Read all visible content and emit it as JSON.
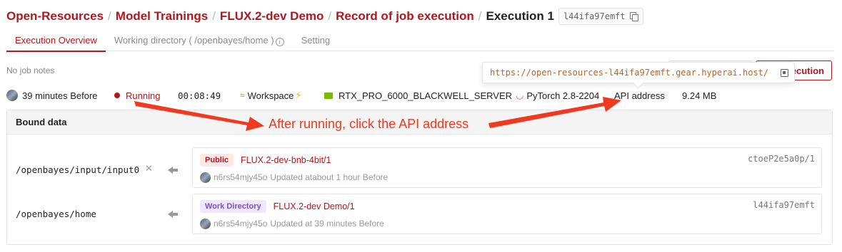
{
  "breadcrumb": {
    "items": [
      "Open-Resources",
      "Model Trainings",
      "FLUX.2-dev Demo",
      "Record of job execution"
    ],
    "separator": "/",
    "current": "Execution 1",
    "id": "l44ifa97emft"
  },
  "tabs": [
    {
      "label": "Execution Overview",
      "active": true
    },
    {
      "label": "Working directory ( /openbayes/home )",
      "active": false
    },
    {
      "label": "Setting",
      "active": false
    }
  ],
  "notes": "No job notes",
  "actions": {
    "execution_label": "Execution"
  },
  "tooltip": {
    "url": "https://open-resources-l44ifa97emft.gear.hyperai.host/"
  },
  "status": {
    "time_ago": "39 minutes Before",
    "state": "Running",
    "duration": "00:08:49",
    "workspace": "Workspace",
    "gpu": "RTX_PRO_6000_BLACKWELL_SERVER",
    "framework": "PyTorch 2.8-2204",
    "api": "API address",
    "size": "9.24 MB"
  },
  "bound_data": {
    "title": "Bound data",
    "rows": [
      {
        "path": "/openbayes/input/input0",
        "badge": "Public",
        "name": "FLUX.2-dev-bnb-4bit/1",
        "id": "ctoeP2e5a0p/1",
        "user": "n6rs54mjy45o",
        "updated": "Updated atabout 1 hour Before"
      },
      {
        "path": "/openbayes/home",
        "badge": "Work Directory",
        "name": "FLUX.2-dev Demo/1",
        "id": "l44ifa97emft",
        "user": "n6rs54mjy45o",
        "updated": "Updated at 39 minutes Before"
      }
    ]
  },
  "annotation": {
    "text": "After running, click the API address",
    "color": "#f0391f"
  },
  "colors": {
    "accent": "#b4161b",
    "annotation": "#f0391f",
    "tooltip_url": "#c0641c"
  }
}
